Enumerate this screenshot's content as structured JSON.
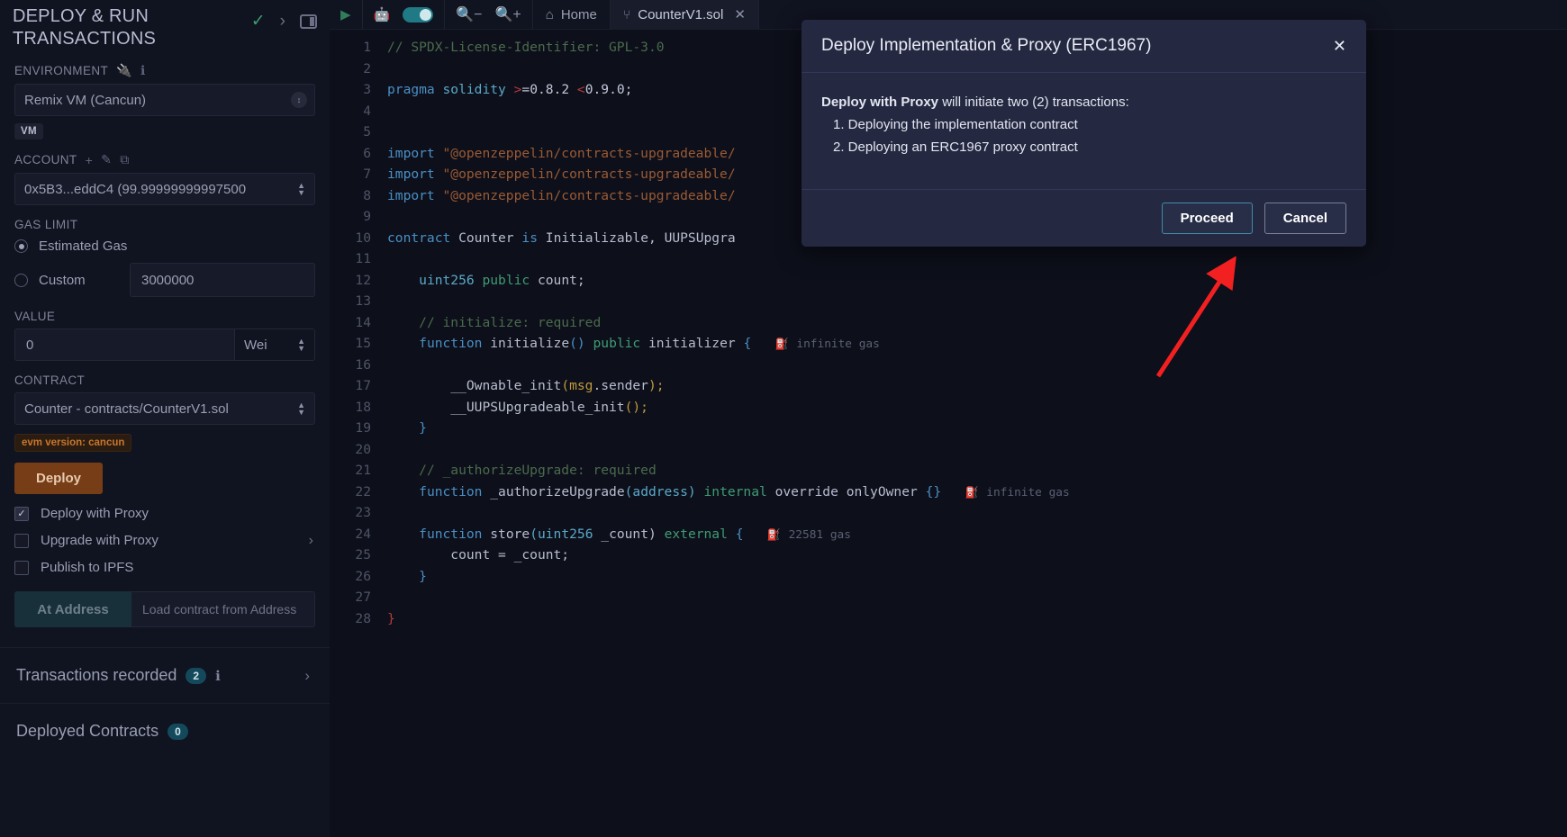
{
  "sidebar": {
    "title": "DEPLOY & RUN TRANSACTIONS",
    "head_icons": {
      "check": "check-icon",
      "chevron": "chevron-right-icon",
      "layout": "layout-panel-icon"
    },
    "environment": {
      "label": "ENVIRONMENT",
      "plug_icon": "plug-icon",
      "info_icon": "info-icon",
      "value": "Remix VM (Cancun)",
      "badge": "VM"
    },
    "account": {
      "label": "ACCOUNT",
      "add_icon": "plus-icon",
      "edit_icon": "edit-icon",
      "copy_icon": "copy-icon",
      "value": "0x5B3...eddC4 (99.99999999997500"
    },
    "gas_limit": {
      "label": "GAS LIMIT",
      "estimated_label": "Estimated Gas",
      "estimated_selected": true,
      "custom_label": "Custom",
      "custom_value": "3000000"
    },
    "value": {
      "label": "VALUE",
      "amount": "0",
      "unit": "Wei"
    },
    "contract": {
      "label": "CONTRACT",
      "value": "Counter - contracts/CounterV1.sol",
      "evm_badge": "evm version: cancun",
      "deploy_button": "Deploy"
    },
    "options": [
      {
        "label": "Deploy with Proxy",
        "checked": true,
        "chevron": false
      },
      {
        "label": "Upgrade with Proxy",
        "checked": false,
        "chevron": true
      },
      {
        "label": "Publish to IPFS",
        "checked": false,
        "chevron": false
      }
    ],
    "at_address": {
      "button": "At Address",
      "placeholder": "Load contract from Address"
    },
    "transactions": {
      "label": "Transactions recorded",
      "count": "2",
      "info_icon": "info-icon"
    },
    "deployed": {
      "label": "Deployed Contracts",
      "count": "0"
    }
  },
  "toolbar": {
    "play_icon": "play-icon",
    "robot_icon": "robot-icon",
    "toggle_icon": "toggle-on-icon",
    "zoom_out_icon": "zoom-out-icon",
    "zoom_in_icon": "zoom-in-icon",
    "home_tab": "Home",
    "home_icon": "home-icon",
    "file_tab": "CounterV1.sol",
    "file_icon": "solidity-icon",
    "close_icon": "close-icon"
  },
  "code": {
    "lines": [
      {
        "n": "1",
        "gas": ""
      },
      {
        "n": "2",
        "gas": ""
      },
      {
        "n": "3",
        "gas": ""
      },
      {
        "n": "4",
        "gas": ""
      },
      {
        "n": "5",
        "gas": ""
      },
      {
        "n": "6",
        "gas": ""
      },
      {
        "n": "7",
        "gas": ""
      },
      {
        "n": "8",
        "gas": ""
      },
      {
        "n": "9",
        "gas": ""
      },
      {
        "n": "10",
        "gas": ""
      },
      {
        "n": "11",
        "gas": ""
      },
      {
        "n": "12",
        "gas": ""
      },
      {
        "n": "13",
        "gas": ""
      },
      {
        "n": "14",
        "gas": ""
      },
      {
        "n": "15",
        "gas": "infinite gas"
      },
      {
        "n": "16",
        "gas": ""
      },
      {
        "n": "17",
        "gas": ""
      },
      {
        "n": "18",
        "gas": ""
      },
      {
        "n": "19",
        "gas": ""
      },
      {
        "n": "20",
        "gas": ""
      },
      {
        "n": "21",
        "gas": ""
      },
      {
        "n": "22",
        "gas": "infinite gas"
      },
      {
        "n": "23",
        "gas": ""
      },
      {
        "n": "24",
        "gas": "22581 gas"
      },
      {
        "n": "25",
        "gas": ""
      },
      {
        "n": "26",
        "gas": ""
      },
      {
        "n": "27",
        "gas": ""
      },
      {
        "n": "28",
        "gas": ""
      }
    ],
    "text": {
      "l1": "// SPDX-License-Identifier: GPL-3.0",
      "l3a": "pragma",
      "l3b": "solidity",
      "l3c": ">",
      "l3d": "=0.8.2 ",
      "l3e": "<",
      "l3f": "0.9.0;",
      "l6": "import",
      "l6s": "\"@openzeppelin/contracts-upgradeable/",
      "l7": "import",
      "l7s": "\"@openzeppelin/contracts-upgradeable/",
      "l8": "import",
      "l8s": "\"@openzeppelin/contracts-upgradeable/",
      "l10a": "contract",
      "l10b": "Counter",
      "l10c": "is",
      "l10d": "Initializable, UUPSUpgra",
      "l12a": "uint256",
      "l12b": "public",
      "l12c": "count;",
      "l14": "// initialize: required",
      "l15a": "function",
      "l15b": "initialize",
      "l15c": "()",
      "l15d": "public",
      "l15e": "initializer",
      "l15f": "{",
      "l17a": "__Ownable_init",
      "l17b": "(",
      "l17c": "msg",
      "l17d": ".sender",
      "l17e": ");",
      "l18a": "__UUPSUpgradeable_init",
      "l18b": "();",
      "l19": "}",
      "l21": "// _authorizeUpgrade: required",
      "l22a": "function",
      "l22b": "_authorizeUpgrade",
      "l22c": "(address)",
      "l22d": "internal",
      "l22e": "override",
      "l22f": "onlyOwner",
      "l22g": "{}",
      "l24a": "function",
      "l24b": "store",
      "l24c": "(uint256",
      "l24d": "_count)",
      "l24e": "external",
      "l24f": "{",
      "l25": "count = _count;",
      "l26": "}",
      "l28": "}"
    }
  },
  "modal": {
    "title": "Deploy Implementation & Proxy (ERC1967)",
    "close_icon": "close-icon",
    "lead_bold": "Deploy with Proxy",
    "lead_rest": " will initiate two (2) transactions:",
    "steps": [
      "1. Deploying the implementation contract",
      "2. Deploying an ERC1967 proxy contract"
    ],
    "proceed_label": "Proceed",
    "cancel_label": "Cancel"
  },
  "annotation": {
    "arrow_color": "#f22020",
    "points_to": "Proceed"
  }
}
